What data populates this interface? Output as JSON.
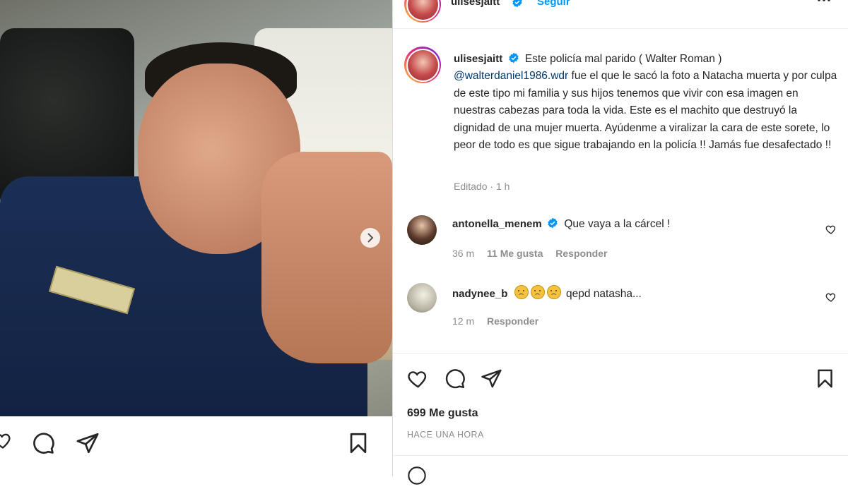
{
  "post": {
    "username": "ulisesjaitt",
    "follow_label": "Seguir",
    "caption_prefix": "Este policía mal parido ( Walter Roman )",
    "caption_mention": "@walterdaniel1986.wdr",
    "caption_rest": " fue el que le sacó la foto a Natacha muerta y por culpa de este tipo mi familia y sus hijos tenemos que vivir con esa imagen en nuestras cabezas para toda la vida. Este es el machito que destruyó la dignidad de una mujer muerta. Ayúdenme a viralizar la cara de este sorete, lo peor de todo es que sigue trabajando en la policía !! Jamás fue desafectado !!",
    "edited_label": "Editado",
    "edited_time": "1 h",
    "likes": "699 Me gusta",
    "time_ago": "HACE UNA HORA"
  },
  "comments": [
    {
      "username": "antonella_menem",
      "verified": true,
      "text": "Que vaya a la cárcel !",
      "time": "36 m",
      "likes": "11 Me gusta",
      "reply": "Responder"
    },
    {
      "username": "nadynee_b",
      "verified": false,
      "emoji_count": 3,
      "text": "qepd natasha...",
      "time": "12 m",
      "reply": "Responder"
    }
  ],
  "icons": {
    "like": "heart-icon",
    "comment": "comment-icon",
    "share": "paper-plane-icon",
    "save": "bookmark-icon",
    "options": "more-options-icon",
    "verified": "verified-badge-icon",
    "carousel_next": "chevron-right-icon"
  },
  "colors": {
    "link_blue": "#0095f6",
    "mention_blue": "#00376b",
    "verified_blue": "#0095f6",
    "muted": "#8e8e8e"
  }
}
